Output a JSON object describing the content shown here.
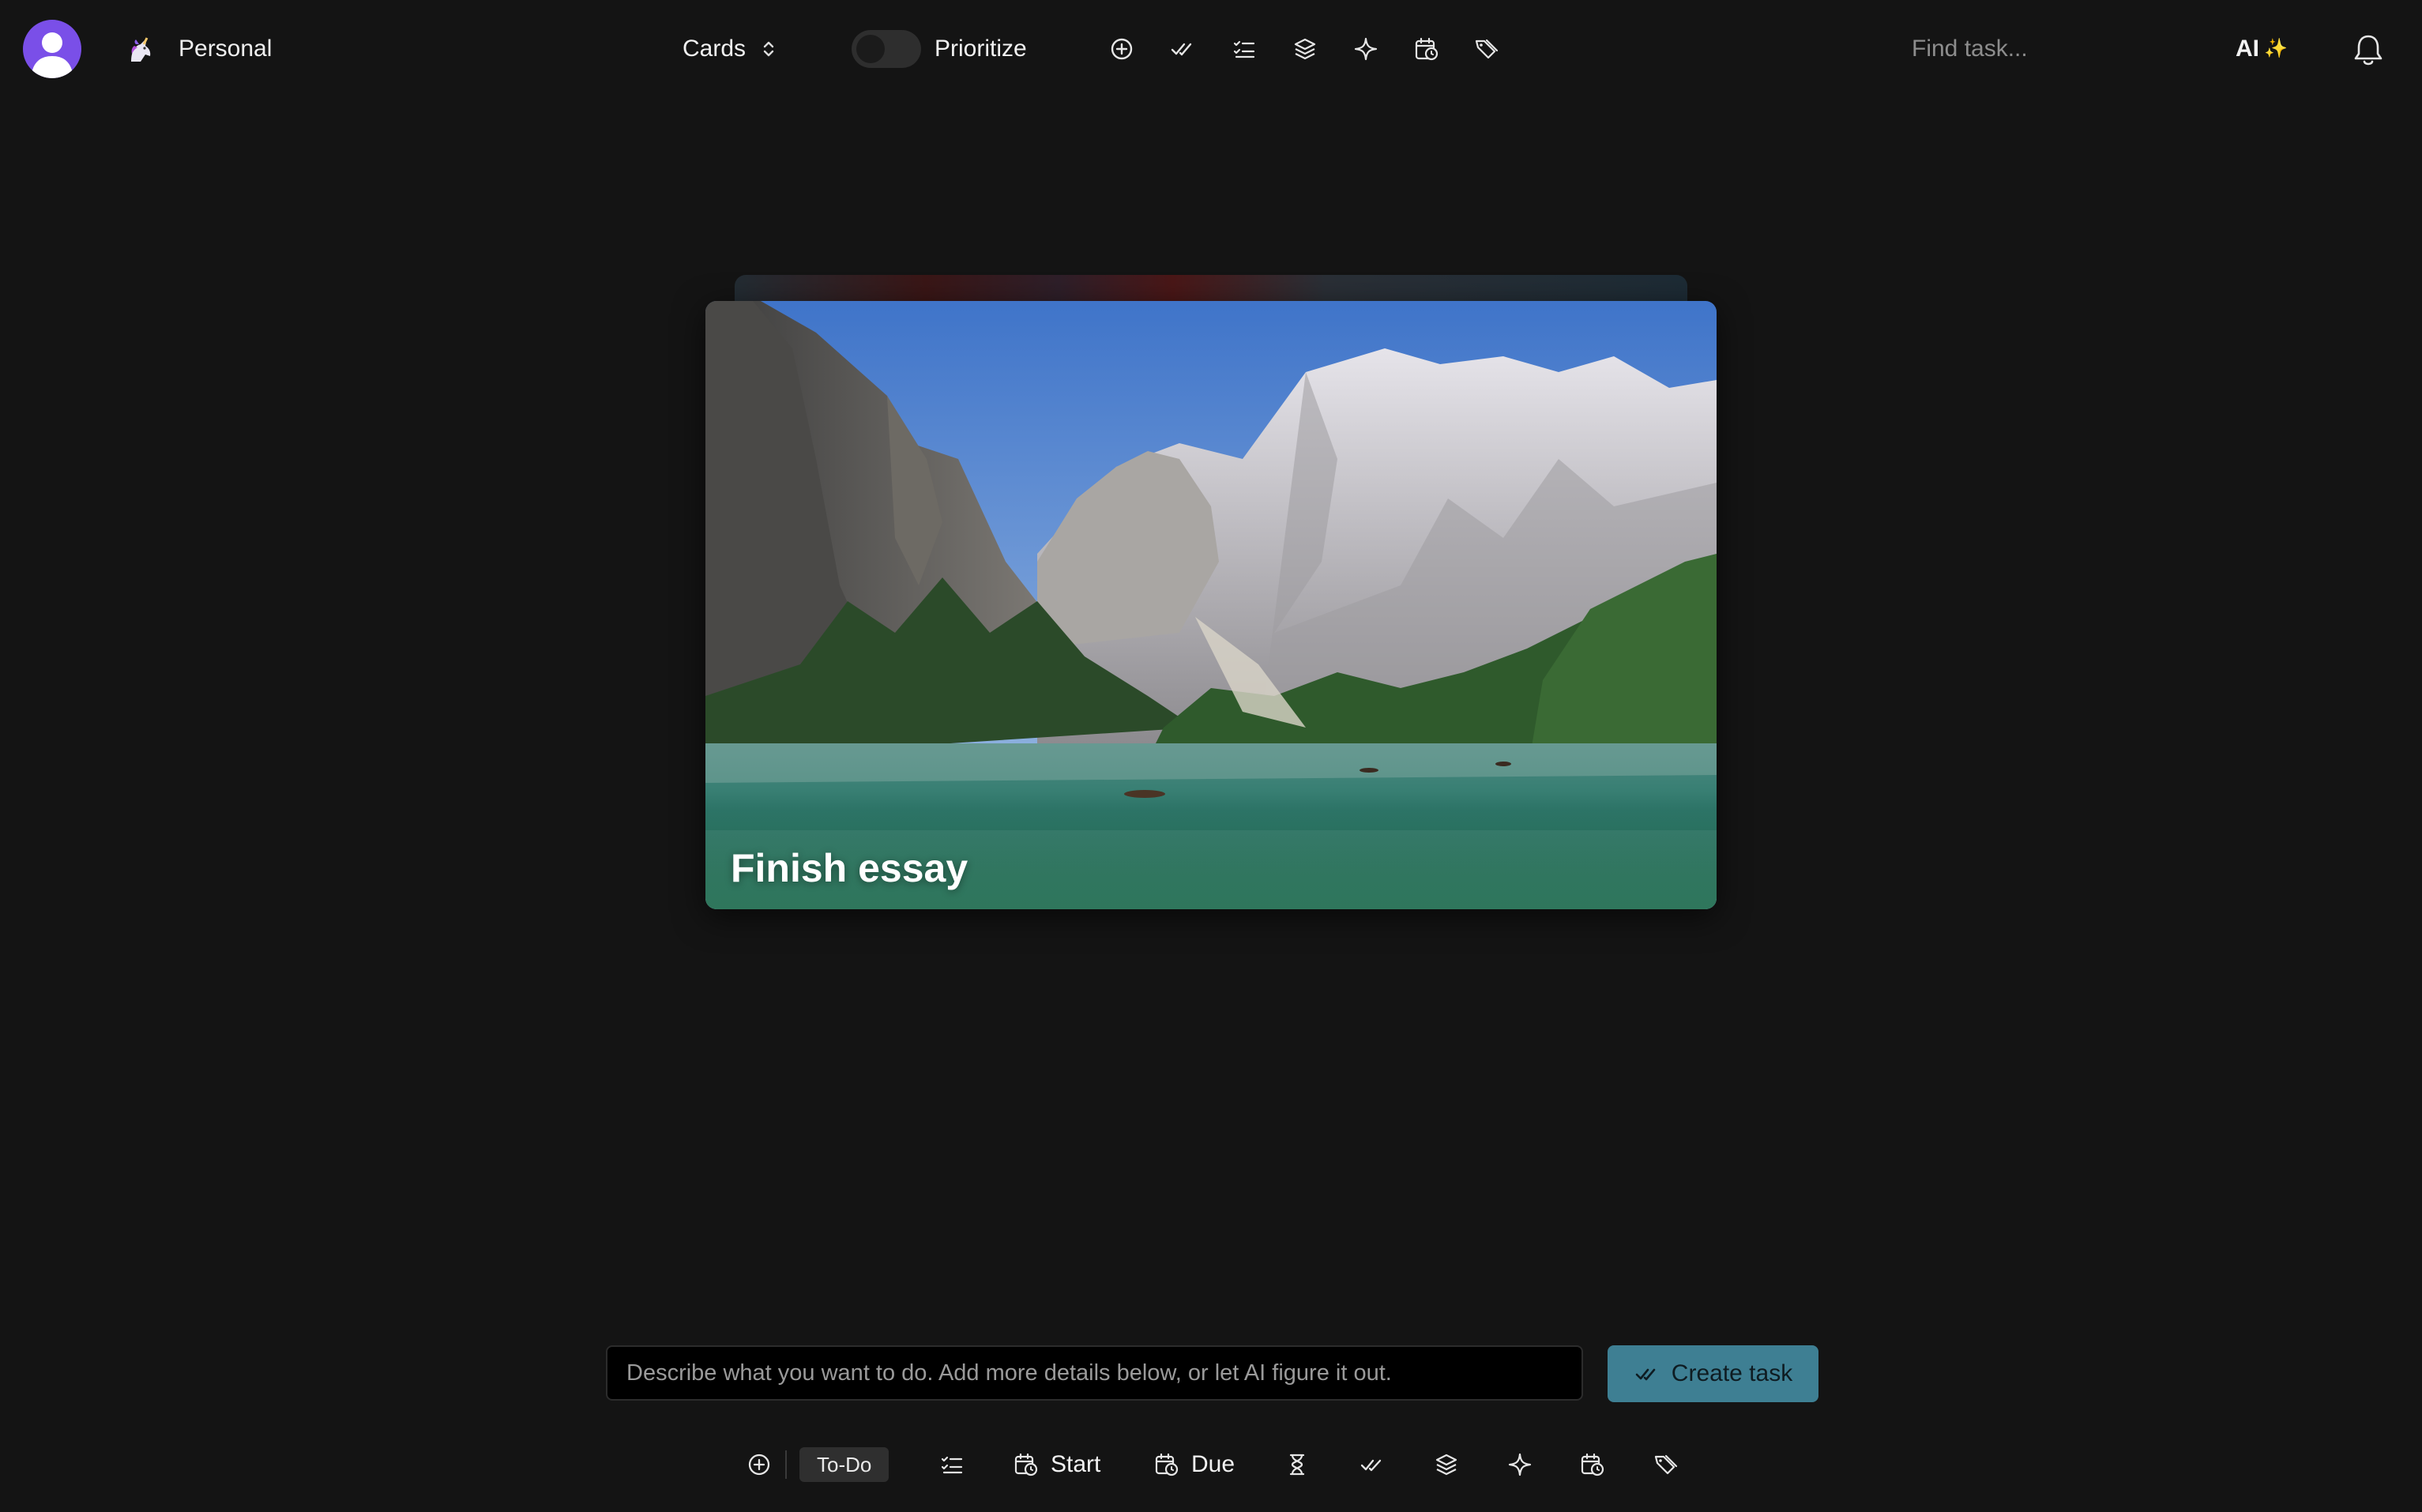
{
  "header": {
    "workspace_name": "Personal",
    "view_mode": "Cards",
    "prioritize_label": "Prioritize",
    "prioritize_enabled": false,
    "search_placeholder": "Find task...",
    "ai_label": "AI",
    "ai_glyph": "✨",
    "toolbar_icons": [
      "plus-circle-icon",
      "double-check-icon",
      "checklist-icon",
      "layers-icon",
      "sparkle-icon",
      "calendar-clock-icon",
      "tags-icon"
    ]
  },
  "card": {
    "title": "Finish essay"
  },
  "composer": {
    "placeholder": "Describe what you want to do. Add more details below, or let AI figure it out.",
    "create_label": "Create task",
    "accent_color": "#3e7f93"
  },
  "bottom_toolbar": {
    "status": "To-Do",
    "start_label": "Start",
    "due_label": "Due"
  }
}
